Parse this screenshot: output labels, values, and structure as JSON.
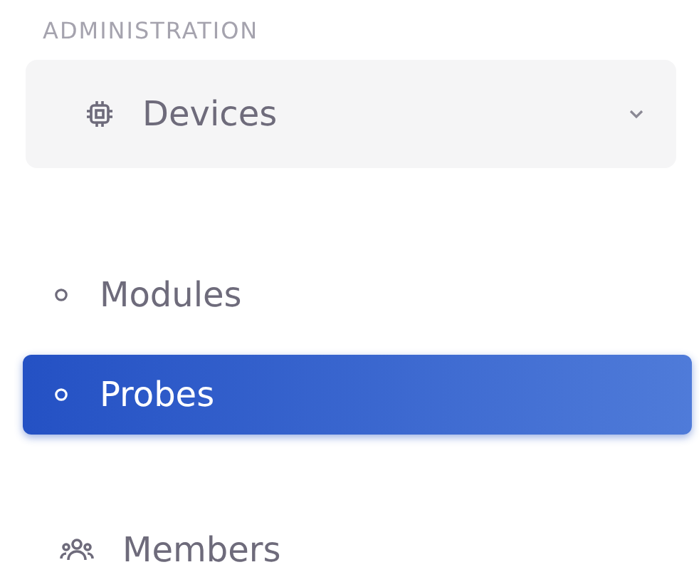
{
  "section_title": "ADMINISTRATION",
  "menu": [
    {
      "label": "Devices",
      "expanded": true,
      "selected": false,
      "children": [
        {
          "label": "Modules",
          "selected": false
        },
        {
          "label": "Probes",
          "selected": true
        }
      ]
    },
    {
      "label": "Members",
      "selected": false
    }
  ]
}
